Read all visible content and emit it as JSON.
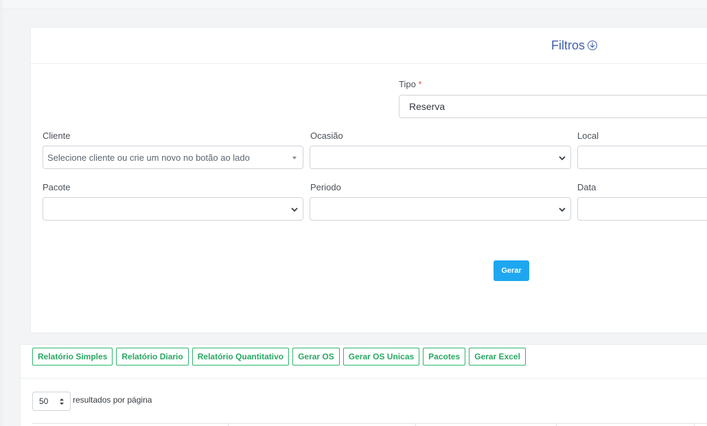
{
  "filters": {
    "title": "Filtros",
    "tipo": {
      "label": "Tipo",
      "required_mark": "*",
      "value": "Reserva"
    },
    "cliente": {
      "label": "Cliente",
      "placeholder": "Selecione cliente ou crie um novo no botão ao lado"
    },
    "ocasiao": {
      "label": "Ocasião",
      "value": ""
    },
    "local": {
      "label": "Local",
      "value": ""
    },
    "pacote": {
      "label": "Pacote",
      "value": ""
    },
    "periodo": {
      "label": "Periodo",
      "value": ""
    },
    "data": {
      "label": "Data",
      "value": ""
    },
    "submit_label": "Gerar"
  },
  "results": {
    "toolbar": [
      {
        "label": "Relatório Simples"
      },
      {
        "label": "Relatório Diario"
      },
      {
        "label": "Relatório Quantitativo"
      },
      {
        "label": "Gerar OS"
      },
      {
        "label": "Gerar OS Unicas"
      },
      {
        "label": "Pacotes"
      },
      {
        "label": "Gerar Excel"
      }
    ],
    "per_page_value": "50",
    "per_page_text": "resultados por página"
  },
  "icons": {
    "filter_toggle": "circle-arrow-down-icon",
    "select_caret": "chevron-down-icon",
    "per_page_caret": "up-down-arrows-icon"
  },
  "colors": {
    "primary_button": "#1ea7f0",
    "title_blue": "#3f5fae",
    "outline_green": "#2fb36d",
    "required_red": "#e74c3c"
  }
}
